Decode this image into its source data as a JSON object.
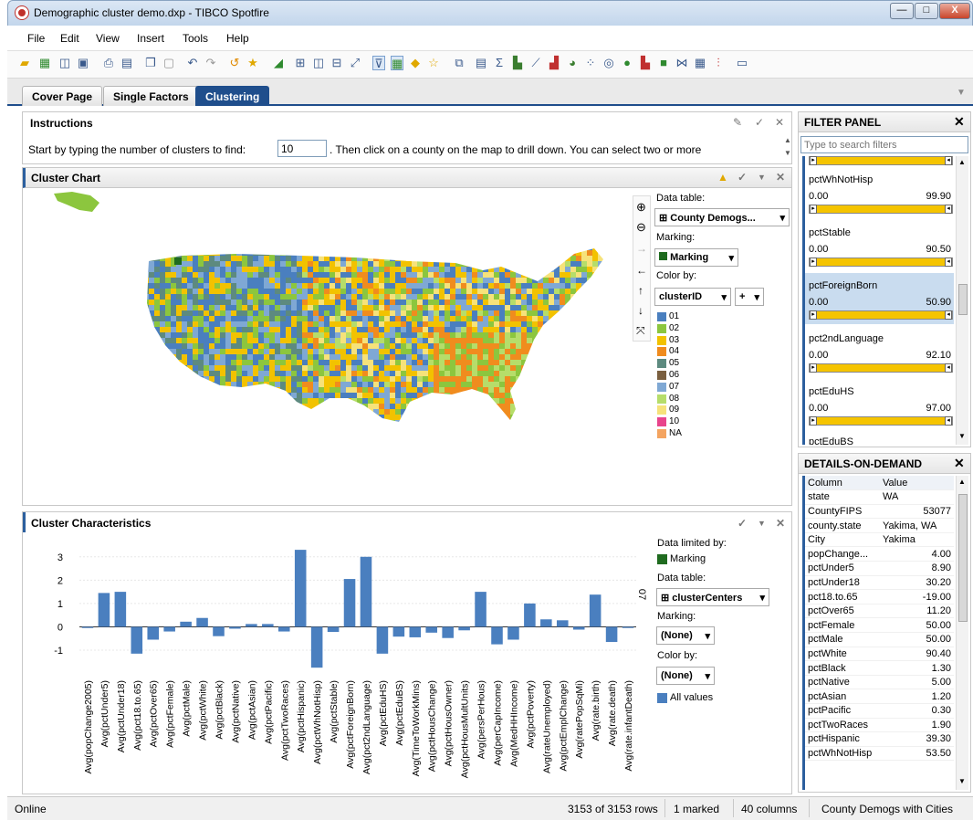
{
  "window": {
    "title": "Demographic cluster demo.dxp - TIBCO Spotfire",
    "btn_min": "—",
    "btn_max": "□",
    "btn_close": "X"
  },
  "menu": [
    "File",
    "Edit",
    "View",
    "Insert",
    "Tools",
    "Help"
  ],
  "tabs": [
    "Cover Page",
    "Single Factors",
    "Clustering"
  ],
  "instructions": {
    "title": "Instructions",
    "text_before": "Start by typing the number of clusters to find:",
    "clusters_value": "10",
    "text_after": ". Then click on a county on the map to drill down.  You can select two or more"
  },
  "map_panel": {
    "title": "Cluster Chart",
    "data_table_label": "Data table:",
    "data_table_value": "County Demogs...",
    "marking_label": "Marking:",
    "marking_value": "Marking",
    "color_by_label": "Color by:",
    "color_by_value": "clusterID",
    "plus_label": "+",
    "legend": [
      {
        "label": "01",
        "color": "#4a7fbf"
      },
      {
        "label": "02",
        "color": "#8cc63e"
      },
      {
        "label": "03",
        "color": "#f2c200"
      },
      {
        "label": "04",
        "color": "#f08c1e"
      },
      {
        "label": "05",
        "color": "#5d8a7f"
      },
      {
        "label": "06",
        "color": "#7a5f3f"
      },
      {
        "label": "07",
        "color": "#7fa8d4"
      },
      {
        "label": "08",
        "color": "#b6dd6a"
      },
      {
        "label": "09",
        "color": "#f6e27a"
      },
      {
        "label": "10",
        "color": "#e8448c"
      },
      {
        "label": "NA",
        "color": "#f4a460"
      }
    ]
  },
  "bar_panel": {
    "title": "Cluster Characteristics",
    "data_limited_label": "Data limited by:",
    "marking_legend": "Marking",
    "marking_color": "#1f6b1f",
    "data_table_label": "Data table:",
    "data_table_value": "clusterCenters",
    "marking_label": "Marking:",
    "marking_value": "(None)",
    "color_by_label": "Color by:",
    "color_by_value": "(None)",
    "all_values_label": "All values",
    "bar_color": "#4a7fbf",
    "axis_side_label": "07"
  },
  "chart_data": {
    "type": "bar",
    "ylim": [
      -1.9,
      3.5
    ],
    "yticks": [
      -1,
      0,
      1,
      2,
      3
    ],
    "categories": [
      "Avg(popChange2005)",
      "Avg(pctUnder5)",
      "Avg(pctUnder18)",
      "Avg(pct18.to.65)",
      "Avg(pctOver65)",
      "Avg(pctFemale)",
      "Avg(pctMale)",
      "Avg(pctWhite)",
      "Avg(pctBlack)",
      "Avg(pctNative)",
      "Avg(pctAsian)",
      "Avg(pctPacific)",
      "Avg(pctTwoRaces)",
      "Avg(pctHispanic)",
      "Avg(pctWhNotHisp)",
      "Avg(pctStable)",
      "Avg(pctForeignBorn)",
      "Avg(pct2ndLanguage)",
      "Avg(pctEduHS)",
      "Avg(pctEduBS)",
      "Avg(TimeToWorkMins)",
      "Avg(pctHousChange)",
      "Avg(pctHousOwner)",
      "Avg(pctHousMultUnits)",
      "Avg(persPerHous)",
      "Avg(perCapIncome)",
      "Avg(MedHHIncome)",
      "Avg(pctPoverty)",
      "Avg(rateUnemployed)",
      "Avg(pctEmplChange)",
      "Avg(ratePopSqMi)",
      "Avg(rate.birth)",
      "Avg(rate.death)",
      "Avg(rate.infantDeath)"
    ],
    "values": [
      -0.05,
      1.45,
      1.5,
      -1.15,
      -0.55,
      -0.2,
      0.22,
      0.38,
      -0.4,
      -0.08,
      0.12,
      0.12,
      -0.2,
      3.3,
      -1.75,
      -0.22,
      2.05,
      3.0,
      -1.15,
      -0.42,
      -0.45,
      -0.25,
      -0.48,
      -0.15,
      1.5,
      -0.75,
      -0.55,
      1.0,
      0.32,
      0.28,
      -0.12,
      1.38,
      -0.65,
      -0.05
    ]
  },
  "filter_panel": {
    "title": "FILTER PANEL",
    "search_placeholder": "Type to search filters",
    "filters": [
      {
        "name": "pctWhNotHisp",
        "min": "0.00",
        "max": "99.90"
      },
      {
        "name": "pctStable",
        "min": "0.00",
        "max": "90.50"
      },
      {
        "name": "pctForeignBorn",
        "min": "0.00",
        "max": "50.90"
      },
      {
        "name": "pct2ndLanguage",
        "min": "0.00",
        "max": "92.10"
      },
      {
        "name": "pctEduHS",
        "min": "0.00",
        "max": "97.00"
      }
    ],
    "partial": "pctEduBS"
  },
  "dod": {
    "title": "DETAILS-ON-DEMAND",
    "col_header": "Column",
    "val_header": "Value",
    "rows": [
      [
        "state",
        "WA"
      ],
      [
        "CountyFIPS",
        "53077"
      ],
      [
        "county.state",
        "Yakima, WA"
      ],
      [
        "City",
        "Yakima"
      ],
      [
        "popChange...",
        "4.00"
      ],
      [
        "pctUnder5",
        "8.90"
      ],
      [
        "pctUnder18",
        "30.20"
      ],
      [
        "pct18.to.65",
        "-19.00"
      ],
      [
        "pctOver65",
        "11.20"
      ],
      [
        "pctFemale",
        "50.00"
      ],
      [
        "pctMale",
        "50.00"
      ],
      [
        "pctWhite",
        "90.40"
      ],
      [
        "pctBlack",
        "1.30"
      ],
      [
        "pctNative",
        "5.00"
      ],
      [
        "pctAsian",
        "1.20"
      ],
      [
        "pctPacific",
        "0.30"
      ],
      [
        "pctTwoRaces",
        "1.90"
      ],
      [
        "pctHispanic",
        "39.30"
      ],
      [
        "pctWhNotHisp",
        "53.50"
      ]
    ]
  },
  "status": {
    "left": "Online",
    "rows": "3153 of 3153 rows",
    "marked": "1 marked",
    "columns": "40 columns",
    "table": "County Demogs with Cities"
  }
}
